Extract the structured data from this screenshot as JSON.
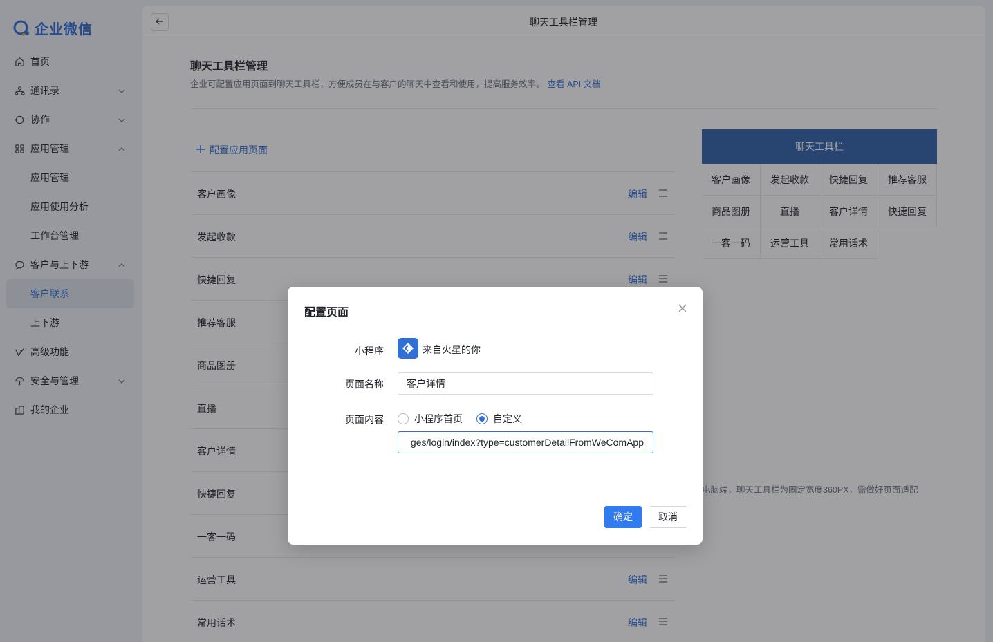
{
  "app": {
    "logo_text": "企业微信"
  },
  "sidebar": {
    "items": [
      {
        "label": "首页",
        "icon": "home-icon"
      },
      {
        "label": "通讯录",
        "icon": "contacts-icon"
      },
      {
        "label": "协作",
        "icon": "collab-icon"
      },
      {
        "label": "应用管理",
        "icon": "apps-icon"
      },
      {
        "label": "应用管理"
      },
      {
        "label": "应用使用分析"
      },
      {
        "label": "工作台管理"
      },
      {
        "label": "客户与上下游",
        "icon": "chat-bubble-icon"
      },
      {
        "label": "客户联系"
      },
      {
        "label": "上下游"
      },
      {
        "label": "高级功能",
        "icon": "advanced-icon"
      },
      {
        "label": "安全与管理",
        "icon": "umbrella-icon"
      },
      {
        "label": "我的企业",
        "icon": "building-icon"
      }
    ],
    "active": "客户联系"
  },
  "header": {
    "title": "聊天工具栏管理"
  },
  "section": {
    "title": "聊天工具栏管理",
    "description": "企业可配置应用页面到聊天工具栏，方便成员在与客户的聊天中查看和使用，提高服务效率。",
    "api_link": "查看 API 文档"
  },
  "add_link": "配置应用页面",
  "list": {
    "edit_label": "编辑",
    "items": [
      "客户画像",
      "发起收款",
      "快捷回复",
      "推荐客服",
      "商品图册",
      "直播",
      "客户详情",
      "快捷回复",
      "一客一码",
      "运营工具",
      "常用话术"
    ]
  },
  "preview": {
    "title": "聊天工具栏",
    "cells": [
      "客户画像",
      "发起收款",
      "快捷回复",
      "推荐客服",
      "商品图册",
      "直播",
      "客户详情",
      "快捷回复",
      "一客一码",
      "运营工具",
      "常用话术"
    ],
    "note": "电脑端，聊天工具栏为固定宽度360PX，需做好页面适配"
  },
  "modal": {
    "title": "配置页面",
    "miniprogram_label": "小程序",
    "miniprogram_name": "来自火星的你",
    "page_name_label": "页面名称",
    "page_name_value": "客户详情",
    "page_content_label": "页面内容",
    "radio_home": "小程序首页",
    "radio_custom": "自定义",
    "selected_option": "自定义",
    "url_value": "ges/login/index?type=customerDetailFromWeComApp",
    "confirm": "确定",
    "cancel": "取消"
  },
  "colors": {
    "accent": "#2f7bef",
    "preview_header": "#2f5fa8"
  }
}
